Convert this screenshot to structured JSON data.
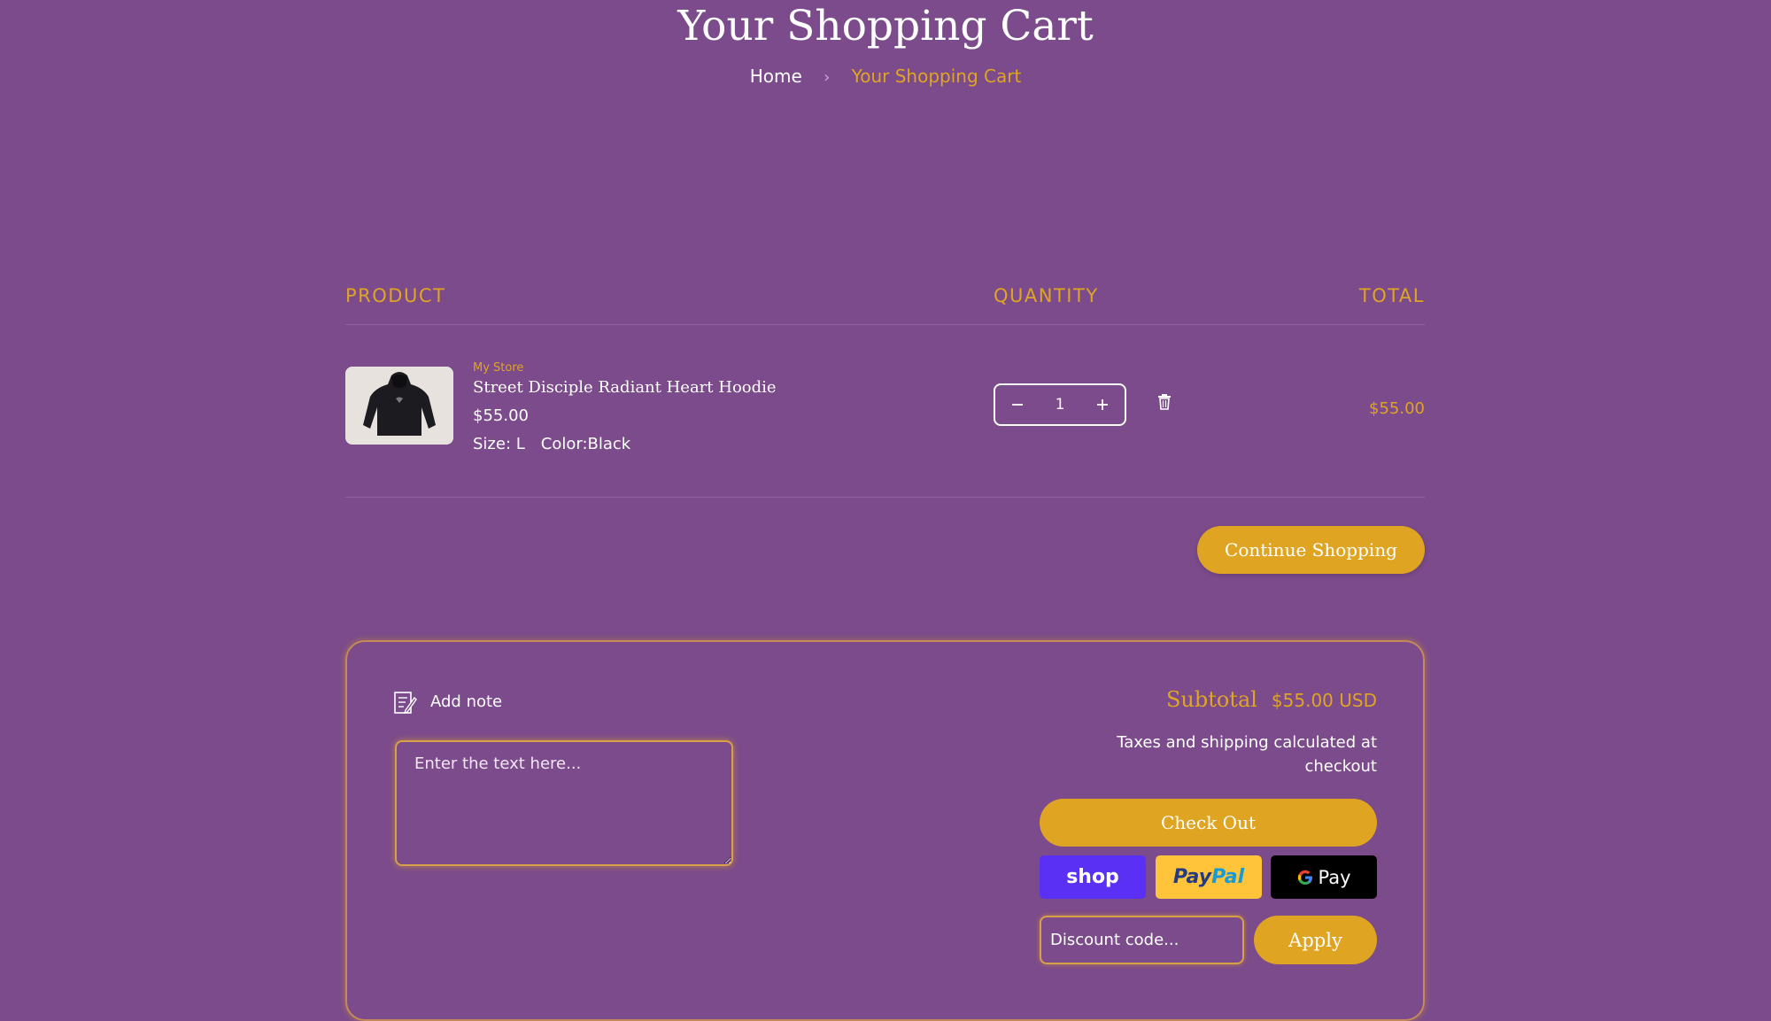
{
  "page": {
    "title": "Your Shopping Cart",
    "colors": {
      "background": "#7b4b8b",
      "accent": "#dfa522",
      "text": "#ffffff"
    }
  },
  "breadcrumb": {
    "home": "Home",
    "separator": "›",
    "current": "Your Shopping Cart"
  },
  "table": {
    "headers": {
      "product": "PRODUCT",
      "quantity": "QUANTITY",
      "total": "TOTAL"
    }
  },
  "cart_items": [
    {
      "vendor": "My Store",
      "name": "Street Disciple Radiant Heart Hoodie",
      "price": "$55.00",
      "size_label": "Size: L",
      "color_label": "Color:Black",
      "quantity": "1",
      "line_total": "$55.00",
      "image_icon": "black-hoodie-image",
      "remove_icon": "trash-icon"
    }
  ],
  "actions": {
    "continue_shopping": "Continue Shopping"
  },
  "note": {
    "label": "Add note",
    "placeholder": "Enter the text here...",
    "icon": "note-icon"
  },
  "summary": {
    "subtotal_label": "Subtotal",
    "subtotal_value": "$55.00 USD",
    "tax_note": "Taxes and shipping calculated at checkout",
    "checkout_label": "Check Out",
    "payment_buttons": {
      "shop": "shop",
      "paypal_1": "Pay",
      "paypal_2": "Pal",
      "gpay": "Pay"
    },
    "discount_placeholder": "Discount code...",
    "apply_label": "Apply"
  }
}
